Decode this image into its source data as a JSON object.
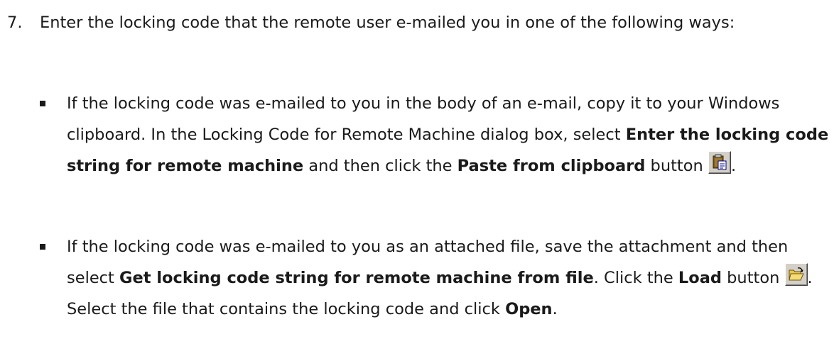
{
  "step": {
    "number": "7.",
    "intro": "Enter the locking code that the remote user e-mailed you in one of the following ways:"
  },
  "bullet1": {
    "text1": "If the locking code was e-mailed to you in the body of an e-mail, copy it to your Windows clipboard. In the Locking Code for Remote Machine dialog box, select ",
    "bold1": "Enter the locking code string for remote machine",
    "text2": " and then click the ",
    "bold2": "Paste from clipboard",
    "text3": " button ",
    "text4": ".",
    "icon": "paste-from-clipboard-icon"
  },
  "bullet2": {
    "text1": "If the locking code was e-mailed to you as an attached file, save the attachment and then select ",
    "bold1": "Get locking code string for remote machine from file",
    "text2": ". Click the ",
    "bold2": "Load",
    "text3": " button ",
    "text4": ". Select the file that contains the locking code and click ",
    "bold3": "Open",
    "text5": ".",
    "icon": "load-file-icon"
  }
}
